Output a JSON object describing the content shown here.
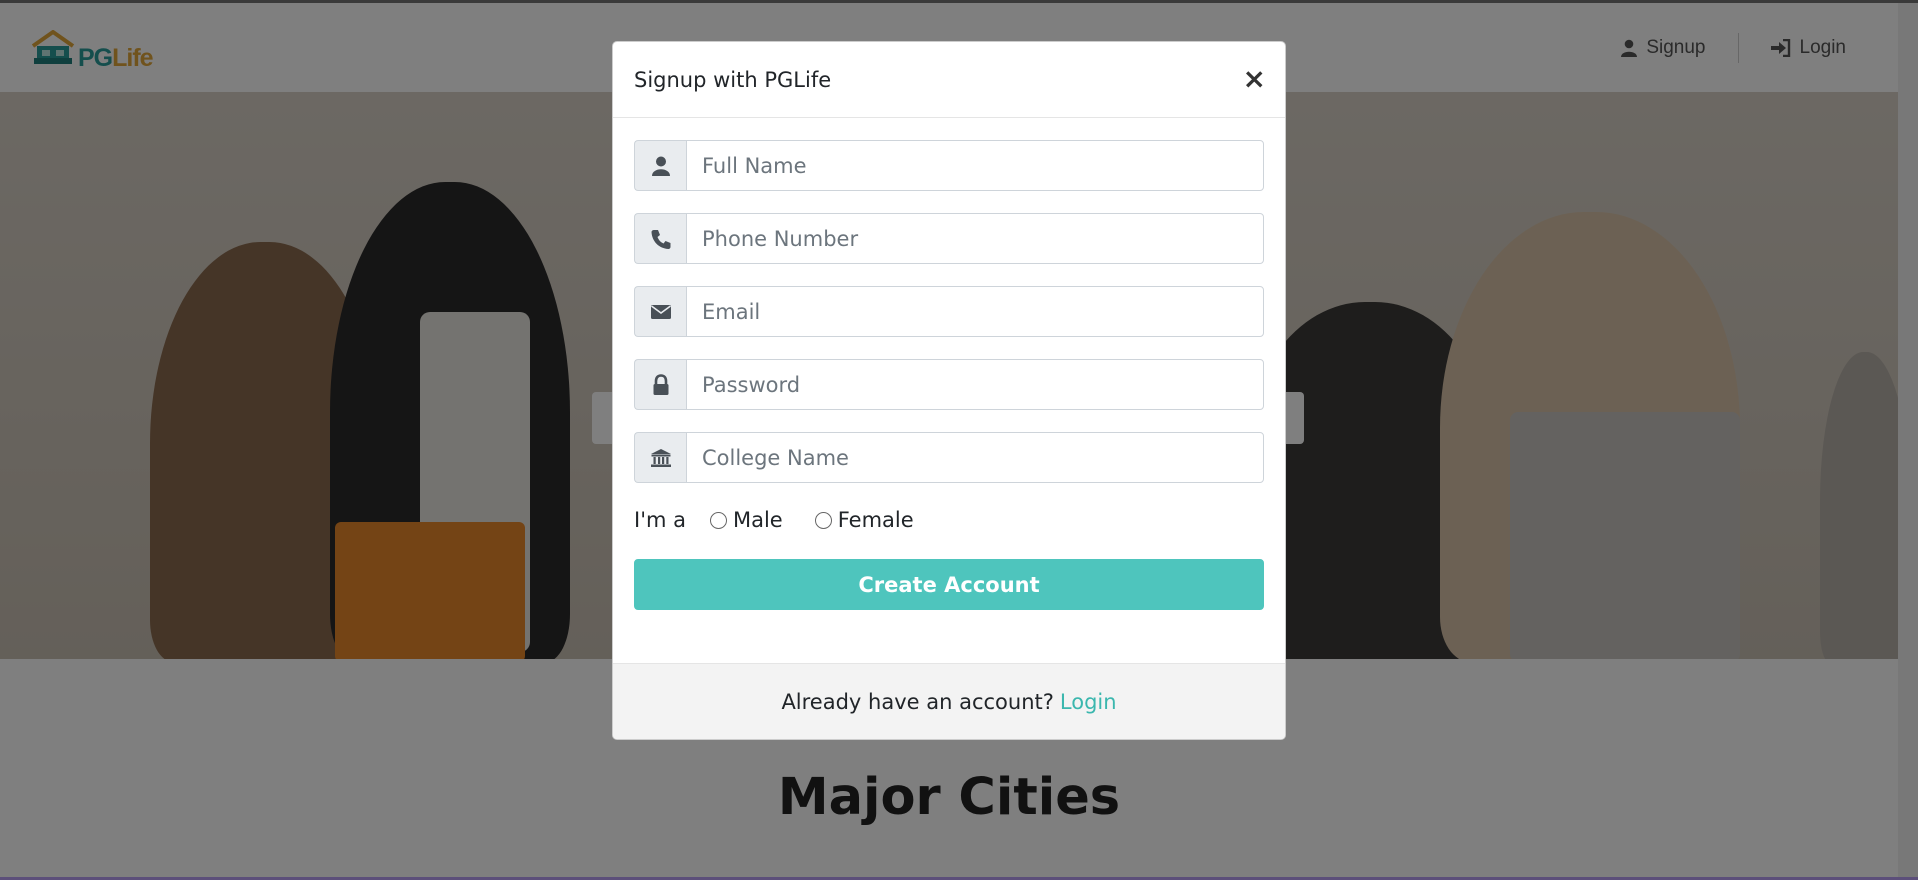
{
  "navbar": {
    "logo_text_pg": "PG",
    "logo_text_life": "Life",
    "signup_label": "Signup",
    "login_label": "Login"
  },
  "page": {
    "section_title": "Major Cities"
  },
  "modal": {
    "title": "Signup with PGLife",
    "close_label": "×",
    "fields": {
      "full_name": {
        "placeholder": "Full Name",
        "icon": "user-icon"
      },
      "phone": {
        "placeholder": "Phone Number",
        "icon": "phone-icon"
      },
      "email": {
        "placeholder": "Email",
        "icon": "envelope-icon"
      },
      "password": {
        "placeholder": "Password",
        "icon": "lock-icon"
      },
      "college": {
        "placeholder": "College Name",
        "icon": "university-icon"
      }
    },
    "gender": {
      "label": "I'm a",
      "male": "Male",
      "female": "Female"
    },
    "submit_label": "Create Account",
    "footer": {
      "text": "Already have an account?",
      "link": "Login"
    }
  },
  "colors": {
    "accent": "#4ec5bd",
    "link": "#3bb7ae",
    "logo_pg": "#2a9d9a",
    "logo_life": "#e0a63a"
  }
}
